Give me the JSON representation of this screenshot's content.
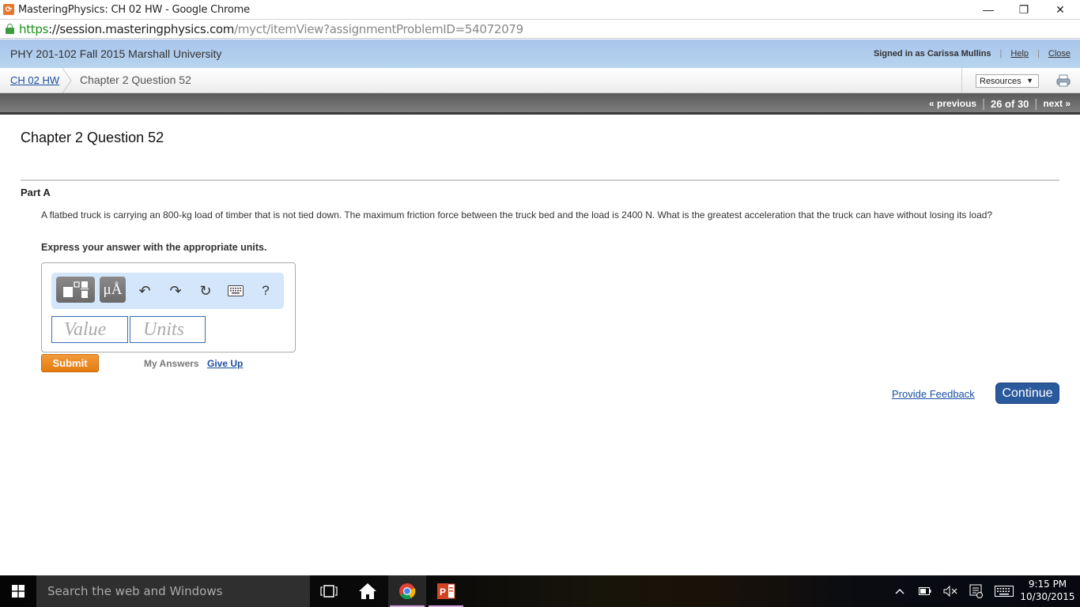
{
  "window": {
    "title": "MasteringPhysics: CH 02 HW - Google Chrome",
    "controls": {
      "minimize": "—",
      "restore": "❐",
      "close": "✕"
    }
  },
  "address_bar": {
    "scheme": "https",
    "host": "://session.masteringphysics.com",
    "path": "/myct/itemView?assignmentProblemID=54072079"
  },
  "site_header": {
    "course": "PHY 201-102 Fall 2015 Marshall University",
    "signed_in": "Signed in as Carissa Mullins",
    "help": "Help",
    "close": "Close"
  },
  "breadcrumb": {
    "parent": "CH 02 HW",
    "current": "Chapter 2 Question 52",
    "resources": "Resources",
    "resources_arrow": "▼"
  },
  "nav": {
    "previous": "« previous",
    "position": "26 of 30",
    "next": "next »"
  },
  "main": {
    "title": "Chapter 2 Question 52",
    "part": "Part A",
    "question": "A flatbed truck is carrying an 800-kg load of timber that is not tied down. The maximum friction force between the truck bed and the load is 2400 N. What is the greatest acceleration that the truck can have without losing its load?",
    "instruction": "Express your answer with the appropriate units.",
    "toolbar": {
      "units_label": "μÅ",
      "undo": "↶",
      "redo": "↷",
      "reset": "↻",
      "help": "?"
    },
    "value_placeholder": "Value",
    "units_placeholder": "Units",
    "submit": "Submit",
    "my_answers": "My Answers",
    "give_up": "Give Up",
    "feedback": "Provide Feedback",
    "continue": "Continue"
  },
  "taskbar": {
    "search_placeholder": "Search the web and Windows",
    "time": "9:15 PM",
    "date": "10/30/2015"
  }
}
